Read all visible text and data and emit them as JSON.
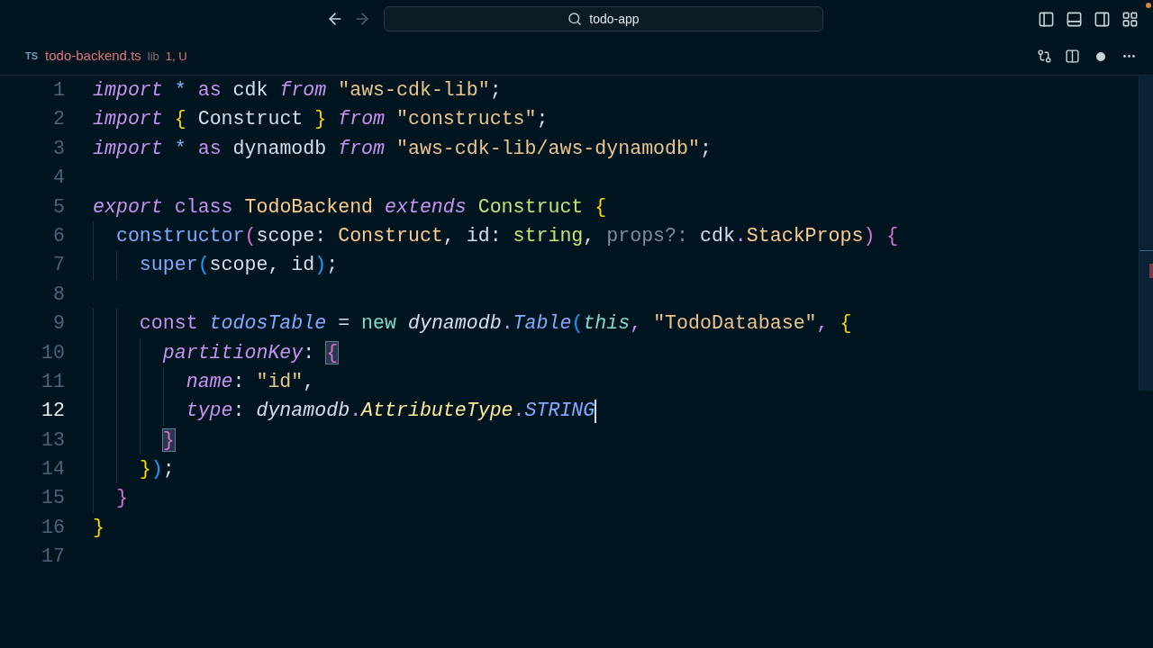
{
  "title_bar": {
    "back_disabled": false,
    "forward_disabled": true,
    "search": {
      "value": "todo-app"
    }
  },
  "tab": {
    "lang_badge": "TS",
    "filename": "todo-backend.ts",
    "folder": "lib",
    "problems": "1, U",
    "unsaved": true
  },
  "editor": {
    "lines": [
      {
        "number": "1",
        "active": false,
        "tokens": [
          {
            "text": "import ",
            "kind": "ctrl"
          },
          {
            "text": "* ",
            "kind": "op"
          },
          {
            "text": "as ",
            "kind": "storage"
          },
          {
            "text": "cdk ",
            "kind": "plain"
          },
          {
            "text": "from ",
            "kind": "ctrl"
          },
          {
            "text": "\"aws-cdk-lib\"",
            "kind": "string"
          },
          {
            "text": ";",
            "kind": "plain"
          }
        ]
      },
      {
        "number": "2",
        "active": false,
        "tokens": [
          {
            "text": "import ",
            "kind": "ctrl"
          },
          {
            "text": "{",
            "kind": "brace1"
          },
          {
            "text": " Construct ",
            "kind": "plain"
          },
          {
            "text": "} ",
            "kind": "brace1"
          },
          {
            "text": "from ",
            "kind": "ctrl"
          },
          {
            "text": "\"constructs\"",
            "kind": "string"
          },
          {
            "text": ";",
            "kind": "plain"
          }
        ]
      },
      {
        "number": "3",
        "active": false,
        "tokens": [
          {
            "text": "import ",
            "kind": "ctrl"
          },
          {
            "text": "* ",
            "kind": "op"
          },
          {
            "text": "as ",
            "kind": "storage"
          },
          {
            "text": "dynamodb ",
            "kind": "plain"
          },
          {
            "text": "from ",
            "kind": "ctrl"
          },
          {
            "text": "\"aws-cdk-lib/aws-dynamodb\"",
            "kind": "string"
          },
          {
            "text": ";",
            "kind": "plain"
          }
        ]
      },
      {
        "number": "4",
        "active": false
      },
      {
        "number": "5",
        "active": false,
        "tokens": [
          {
            "text": "export ",
            "kind": "ctrl"
          },
          {
            "text": "class ",
            "kind": "storage"
          },
          {
            "text": "TodoBackend ",
            "kind": "class"
          },
          {
            "text": "extends ",
            "kind": "ctrl"
          },
          {
            "text": "Construct ",
            "kind": "inherited"
          },
          {
            "text": "{",
            "kind": "brace1"
          }
        ]
      },
      {
        "number": "6",
        "active": false,
        "tokens": [
          {
            "text": "  constructor",
            "kind": "func"
          },
          {
            "text": "(",
            "kind": "brace2"
          },
          {
            "text": "scope: ",
            "kind": "plain"
          },
          {
            "text": "Construct",
            "kind": "class"
          },
          {
            "text": ", id: ",
            "kind": "plain"
          },
          {
            "text": "string",
            "kind": "inherited"
          },
          {
            "text": ", ",
            "kind": "plain"
          },
          {
            "text": "props?:",
            "kind": "dim"
          },
          {
            "text": " cdk",
            "kind": "plain"
          },
          {
            "text": ".",
            "kind": "dot"
          },
          {
            "text": "StackProps",
            "kind": "class"
          },
          {
            "text": ") ",
            "kind": "brace2"
          },
          {
            "text": "{",
            "kind": "brace2"
          }
        ]
      },
      {
        "number": "7",
        "active": false,
        "tokens": [
          {
            "text": "    super",
            "kind": "func"
          },
          {
            "text": "(",
            "kind": "brace3"
          },
          {
            "text": "scope, id",
            "kind": "plain"
          },
          {
            "text": ")",
            "kind": "brace3"
          },
          {
            "text": ";",
            "kind": "plain"
          }
        ]
      },
      {
        "number": "8",
        "active": false
      },
      {
        "number": "9",
        "active": false,
        "tokens": [
          {
            "text": "    const ",
            "kind": "storage"
          },
          {
            "text": "todosTable",
            "kind": "var"
          },
          {
            "text": " = ",
            "kind": "plain"
          },
          {
            "text": "new ",
            "kind": "new"
          },
          {
            "text": "dynamodb",
            "kind": "ns"
          },
          {
            "text": ".",
            "kind": "dot"
          },
          {
            "text": "Table",
            "kind": "var"
          },
          {
            "text": "(",
            "kind": "brace3"
          },
          {
            "text": "this",
            "kind": "this"
          },
          {
            "text": ", ",
            "kind": "dot"
          },
          {
            "text": "\"TodoDatabase\"",
            "kind": "string"
          },
          {
            "text": ", ",
            "kind": "dot"
          },
          {
            "text": "{",
            "kind": "brace1"
          }
        ]
      },
      {
        "number": "10",
        "active": false,
        "tokens": [
          {
            "text": "      partitionKey",
            "kind": "prop"
          },
          {
            "text": ": ",
            "kind": "plain"
          },
          {
            "text": "{",
            "kind": "brace2",
            "matched": true
          }
        ]
      },
      {
        "number": "11",
        "active": false,
        "tokens": [
          {
            "text": "        name",
            "kind": "prop"
          },
          {
            "text": ": ",
            "kind": "plain"
          },
          {
            "text": "\"id\"",
            "kind": "string"
          },
          {
            "text": ",",
            "kind": "plain"
          }
        ]
      },
      {
        "number": "12",
        "active": true,
        "tokens": [
          {
            "text": "        type",
            "kind": "prop"
          },
          {
            "text": ": ",
            "kind": "plain"
          },
          {
            "text": "dynamodb",
            "kind": "ns"
          },
          {
            "text": ".",
            "kind": "dot"
          },
          {
            "text": "AttributeType",
            "kind": "type"
          },
          {
            "text": ".",
            "kind": "dot"
          },
          {
            "text": "STRING",
            "kind": "var"
          }
        ]
      },
      {
        "number": "13",
        "active": false,
        "tokens": [
          {
            "text": "      }",
            "kind": "brace2",
            "matched": true
          }
        ]
      },
      {
        "number": "14",
        "active": false,
        "tokens": [
          {
            "text": "    }",
            "kind": "brace1"
          },
          {
            "text": ")",
            "kind": "brace3"
          },
          {
            "text": ";",
            "kind": "plain"
          }
        ]
      },
      {
        "number": "15",
        "active": false,
        "tokens": [
          {
            "text": "  }",
            "kind": "brace2"
          }
        ]
      },
      {
        "number": "16",
        "active": false,
        "tokens": [
          {
            "text": "}",
            "kind": "brace1"
          }
        ]
      },
      {
        "number": "17",
        "active": false
      }
    ]
  }
}
